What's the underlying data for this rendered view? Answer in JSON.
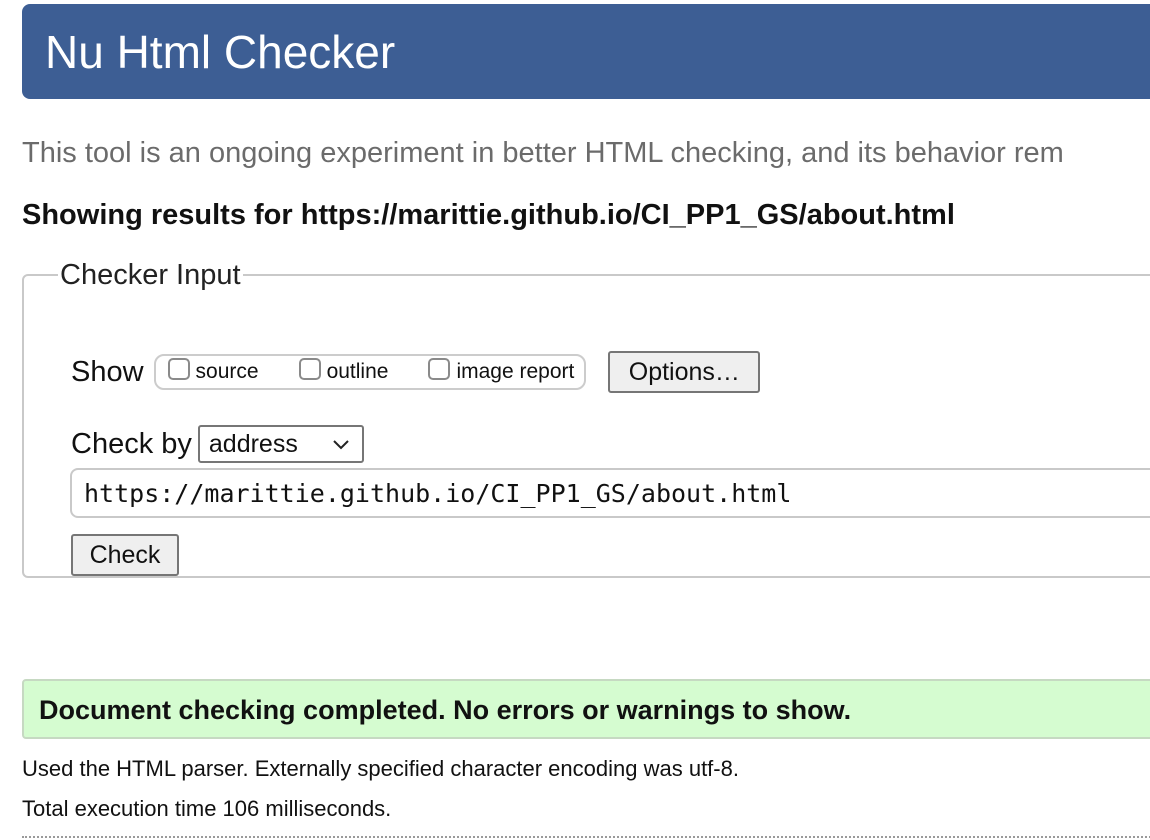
{
  "header": {
    "title": "Nu Html Checker"
  },
  "intro": {
    "text": "This tool is an ongoing experiment in better HTML checking, and its behavior rem"
  },
  "results": {
    "heading_prefix": "Showing results for ",
    "url": "https://marittie.github.io/CI_PP1_GS/about.html"
  },
  "checker_input": {
    "legend": "Checker Input",
    "show_label": "Show",
    "show_options": [
      {
        "label": "source",
        "checked": false
      },
      {
        "label": "outline",
        "checked": false
      },
      {
        "label": "image report",
        "checked": false
      }
    ],
    "options_button": "Options…",
    "check_by_label": "Check by",
    "check_by_selected": "address",
    "url_value": "https://marittie.github.io/CI_PP1_GS/about.html",
    "check_button": "Check"
  },
  "outcome": {
    "message": "Document checking completed. No errors or warnings to show.",
    "parser_note": "Used the HTML parser. Externally specified character encoding was utf-8.",
    "execution_time": "Total execution time 106 milliseconds."
  },
  "colors": {
    "banner": "#3d5e94",
    "success_bg": "#d5fcd0"
  },
  "icons": {
    "select_arrow": "chevron-down-icon"
  }
}
